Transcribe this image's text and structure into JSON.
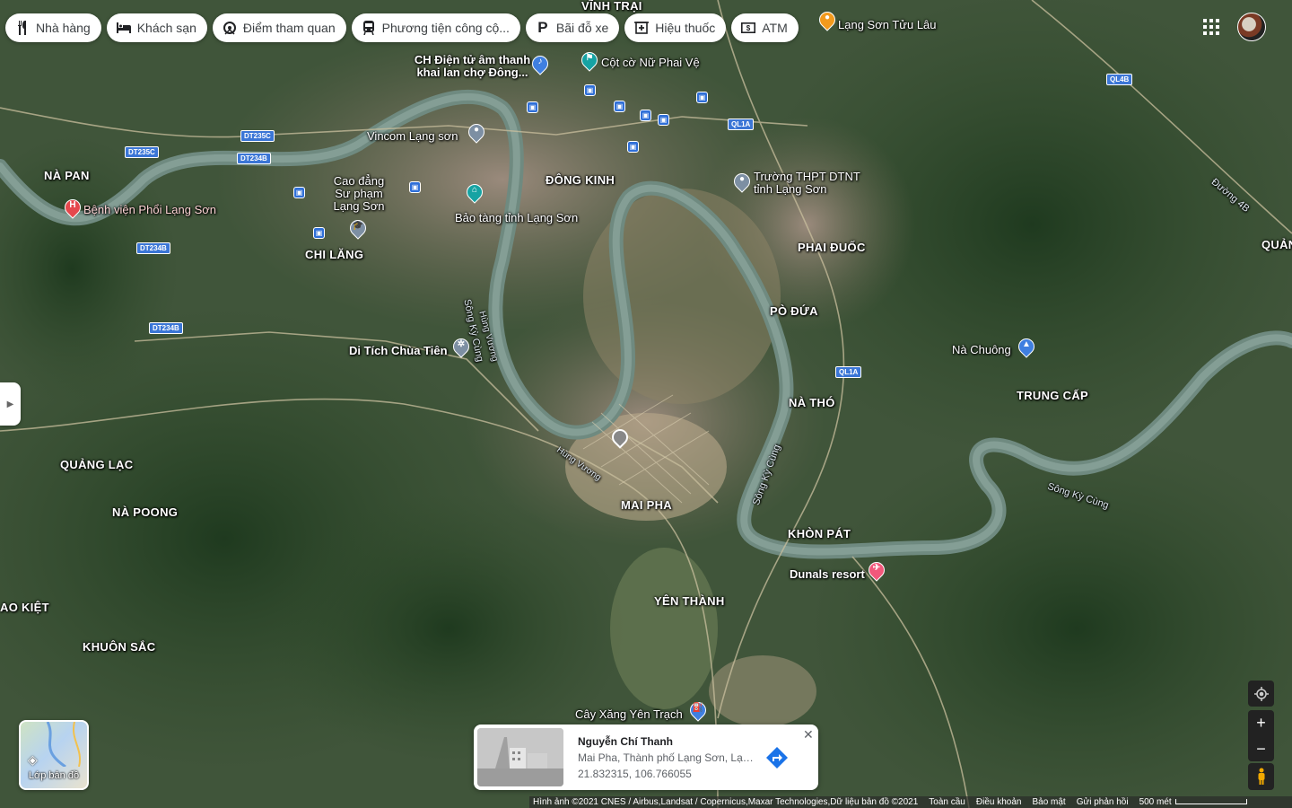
{
  "chips": [
    {
      "icon": "fork-knife-icon",
      "label": "Nhà hàng"
    },
    {
      "icon": "bed-icon",
      "label": "Khách sạn"
    },
    {
      "icon": "attraction-icon",
      "label": "Điểm tham quan"
    },
    {
      "icon": "transit-icon",
      "label": "Phương tiện công cộ..."
    },
    {
      "icon": "parking-icon",
      "label": "Bãi đỗ xe"
    },
    {
      "icon": "pharmacy-icon",
      "label": "Hiệu thuốc"
    },
    {
      "icon": "atm-icon",
      "label": "ATM"
    }
  ],
  "map_labels": {
    "districts": [
      "NÀ PAN",
      "CHI LĂNG",
      "ĐÔNG KINH",
      "PHAI ĐUỐC",
      "PÒ ĐỨA",
      "NÀ THÓ",
      "TRUNG CẤP",
      "QUẢNG LẠC",
      "NÀ POONG",
      "MAI PHA",
      "KHÒN PÁT",
      "YÊN THÀNH",
      "AO KIỆT",
      "KHUÔN SẮC",
      "QUẢN",
      "VĨNH TRẠI"
    ],
    "rivers": [
      "Sông Kỳ Cùng",
      "Sông Kỳ Cùng",
      "Sông Kỳ Cùng"
    ],
    "roads": [
      "Hùng Vương",
      "Hùng Vương",
      "Đường 4B"
    ],
    "shields": [
      "DT235C",
      "DT235C",
      "DT234B",
      "DT234B",
      "DT234B",
      "QL1A",
      "QL1A",
      "QL4B"
    ],
    "pois": {
      "tuu_lau": "Lạng Sơn Tửu Lâu",
      "ch_dien_tu": "CH Điện tử âm thanh khai lan chợ Đông...",
      "cot_co": "Cột cờ Nữ Phai Vệ",
      "vincom": "Vincom Lạng sơn",
      "truong_thpt": "Trường THPT DTNT tỉnh Lạng Sơn",
      "cao_dang": "Cao đẳng Sư phạm Lạng Sơn",
      "bao_tang": "Bảo tàng tỉnh Lạng Sơn",
      "benh_vien": "Bệnh viện Phổi Lạng Sơn",
      "chua_tien": "Di Tích Chùa Tiên",
      "na_chuong": "Nà Chuông",
      "dunals": "Dunals resort",
      "cay_xang": "Cây Xăng Yên Trạch"
    }
  },
  "layers": {
    "label": "Lớp bản đồ"
  },
  "place_card": {
    "name": "Nguyễn Chí Thanh",
    "address": "Mai Pha, Thành phố Lạng Sơn, Lạng Sơn",
    "coords": "21.832315, 106.766055",
    "close": "✕"
  },
  "footer": {
    "attribution": "Hình ảnh ©2021 CNES / Airbus,Landsat / Copernicus,Maxar Technologies,Dữ liệu bản đồ ©2021",
    "links": [
      "Toàn cầu",
      "Điều khoản",
      "Bảo mật",
      "Gửi phản hồi"
    ],
    "scale": "500 mét"
  },
  "controls": {
    "zoom_in": "+",
    "zoom_out": "−"
  }
}
